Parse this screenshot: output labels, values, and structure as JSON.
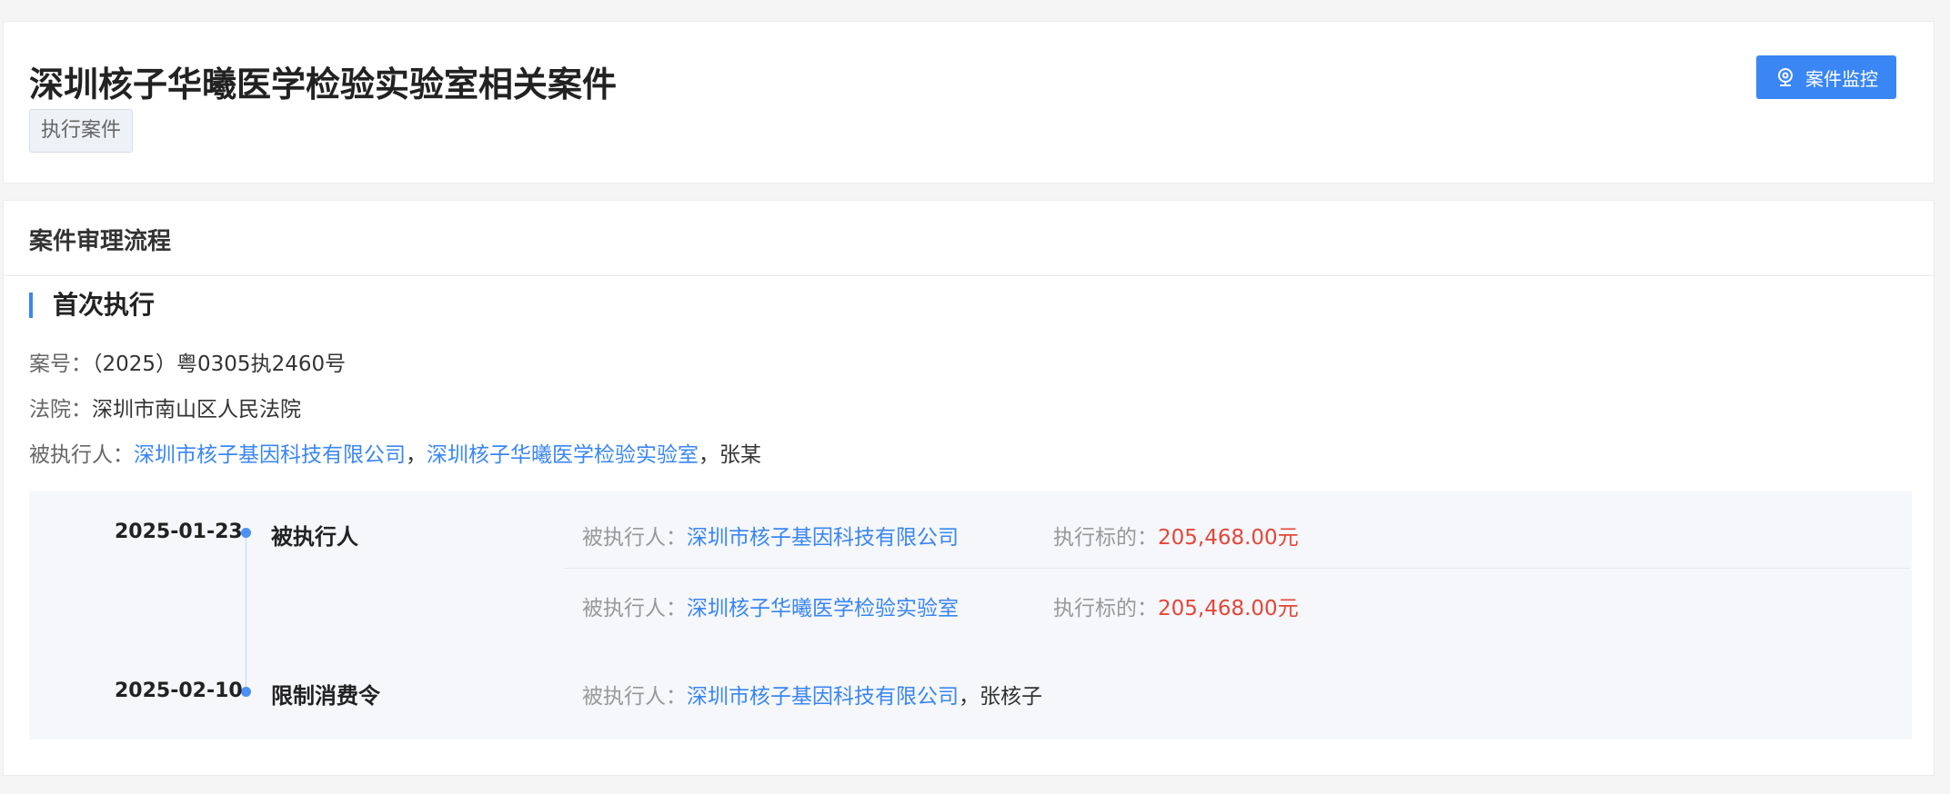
{
  "header": {
    "title": "深圳核子华曦医学检验实验室相关案件",
    "tag": "执行案件",
    "monitor_button": "案件监控"
  },
  "flow": {
    "section_title": "案件审理流程",
    "stage_title": "首次执行",
    "case_no_label": "案号：",
    "case_no": "（2025）粤0305执2460号",
    "court_label": "法院：",
    "court": "深圳市南山区人民法院",
    "executed_label": "被执行人：",
    "executed": [
      "深圳市核子基因科技有限公司",
      "深圳核子华曦医学检验实验室",
      "张某"
    ],
    "separator": "，"
  },
  "timeline": [
    {
      "date": "2025-01-23",
      "event": "被执行人",
      "entries": [
        {
          "party_label": "被执行人：",
          "party": "深圳市核子基因科技有限公司",
          "amount_label": "执行标的：",
          "amount": "205,468.00元"
        },
        {
          "party_label": "被执行人：",
          "party": "深圳核子华曦医学检验实验室",
          "amount_label": "执行标的：",
          "amount": "205,468.00元"
        }
      ]
    },
    {
      "date": "2025-02-10",
      "event": "限制消费令",
      "entries": [
        {
          "party_label": "被执行人：",
          "party": "深圳市核子基因科技有限公司",
          "extra": "张核子"
        }
      ]
    }
  ],
  "colors": {
    "accent": "#3a86f5",
    "amount": "#e4463a"
  }
}
